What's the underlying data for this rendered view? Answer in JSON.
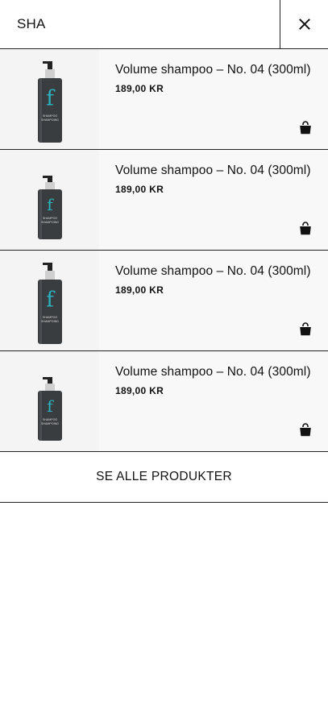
{
  "search": {
    "value": "SHA",
    "close_icon": "close-icon"
  },
  "results": [
    {
      "title": "Volume shampoo – No. 04 (300ml)",
      "price": "189,00 KR",
      "bottle_text": "SHAMPOO\nSHAMPOING",
      "variant": "tall",
      "cart_icon": "shopping-bag-icon"
    },
    {
      "title": "Volume shampoo – No. 04 (300ml)",
      "price": "189,00 KR",
      "bottle_text": "SHAMPOO\nSHAMPOING",
      "variant": "short",
      "cart_icon": "shopping-bag-icon"
    },
    {
      "title": "Volume shampoo – No. 04 (300ml)",
      "price": "189,00 KR",
      "bottle_text": "SHAMPOO\nSHAMPOING",
      "variant": "tall",
      "cart_icon": "shopping-bag-icon"
    },
    {
      "title": "Volume shampoo – No. 04 (300ml)",
      "price": "189,00 KR",
      "bottle_text": "SHAMPOO\nSHAMPOING",
      "variant": "short",
      "cart_icon": "shopping-bag-icon"
    }
  ],
  "see_all_label": "SE ALLE PRODUKTER",
  "colors": {
    "accent_logo": "#2bb3c0",
    "bottle": "#3a3d40",
    "text": "#111111",
    "row_bg": "#f8f8f8"
  }
}
